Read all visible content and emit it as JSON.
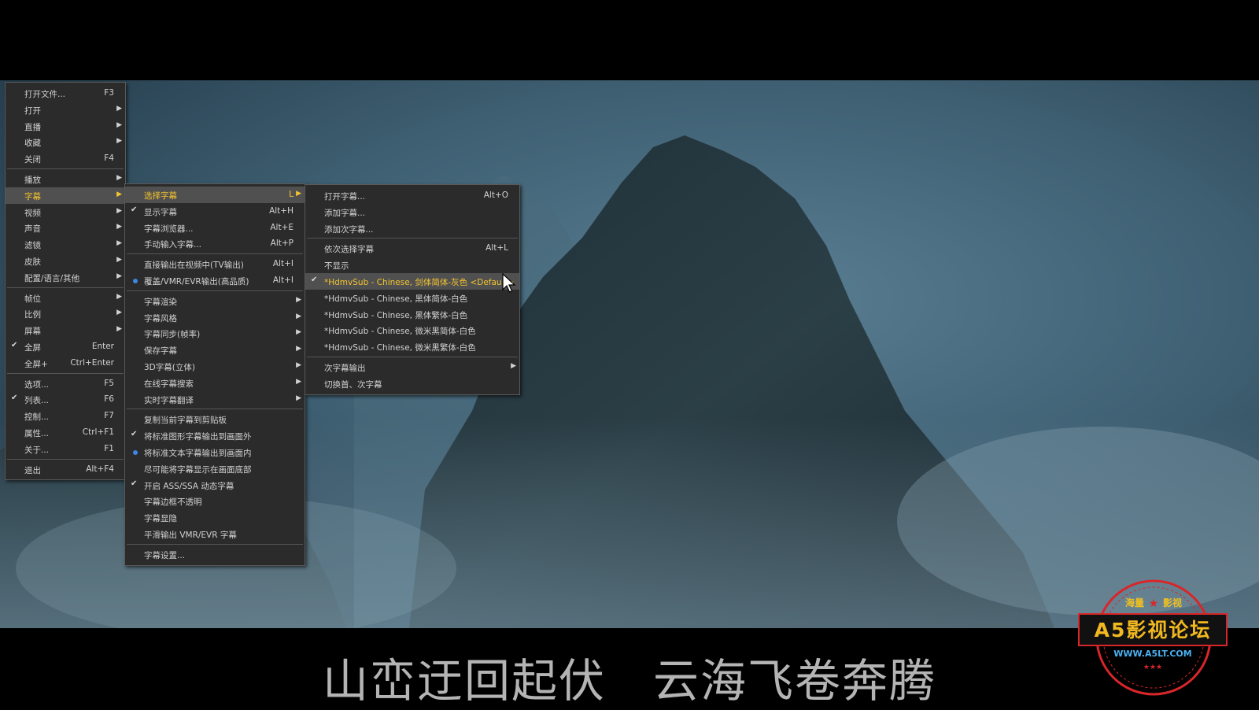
{
  "subtitle": "山峦迂回起伏　云海飞卷奔腾",
  "colors": {
    "highlight_text": "#f4c430",
    "menu_bg": "#2b2b2b",
    "radio_dot": "#3a87e8",
    "watermark_red": "#d8262a"
  },
  "main_menu": {
    "groups": [
      [
        {
          "label": "打开文件...",
          "shortcut": "F3"
        },
        {
          "label": "打开",
          "submenu": true
        },
        {
          "label": "直播",
          "submenu": true
        },
        {
          "label": "收藏",
          "submenu": true
        },
        {
          "label": "关闭",
          "shortcut": "F4"
        }
      ],
      [
        {
          "label": "播放",
          "submenu": true
        },
        {
          "label": "字幕",
          "submenu": true,
          "highlighted": true
        },
        {
          "label": "视频",
          "submenu": true
        },
        {
          "label": "声音",
          "submenu": true
        },
        {
          "label": "滤镜",
          "submenu": true
        },
        {
          "label": "皮肤",
          "submenu": true
        },
        {
          "label": "配置/语言/其他",
          "submenu": true
        }
      ],
      [
        {
          "label": "帧位",
          "submenu": true
        },
        {
          "label": "比例",
          "submenu": true
        },
        {
          "label": "屏幕",
          "submenu": true
        },
        {
          "label": "全屏",
          "shortcut": "Enter",
          "checked": true
        },
        {
          "label": "全屏+",
          "shortcut": "Ctrl+Enter"
        }
      ],
      [
        {
          "label": "选项...",
          "shortcut": "F5"
        },
        {
          "label": "列表...",
          "shortcut": "F6",
          "checked": true
        },
        {
          "label": "控制...",
          "shortcut": "F7"
        },
        {
          "label": "属性...",
          "shortcut": "Ctrl+F1"
        },
        {
          "label": "关于...",
          "shortcut": "F1"
        }
      ],
      [
        {
          "label": "退出",
          "shortcut": "Alt+F4"
        }
      ]
    ]
  },
  "subtitle_menu": {
    "groups": [
      [
        {
          "label": "选择字幕",
          "shortcut": "L",
          "submenu": true,
          "highlighted": true
        },
        {
          "label": "显示字幕",
          "shortcut": "Alt+H",
          "checked": true
        },
        {
          "label": "字幕浏览器...",
          "shortcut": "Alt+E"
        },
        {
          "label": "手动输入字幕...",
          "shortcut": "Alt+P"
        }
      ],
      [
        {
          "label": "直接输出在视频中(TV输出)",
          "shortcut": "Alt+I"
        },
        {
          "label": "覆盖/VMR/EVR输出(高品质)",
          "shortcut": "Alt+I",
          "radio": true
        }
      ],
      [
        {
          "label": "字幕渲染",
          "submenu": true
        },
        {
          "label": "字幕风格",
          "submenu": true
        },
        {
          "label": "字幕同步(帧率)",
          "submenu": true
        },
        {
          "label": "保存字幕",
          "submenu": true
        },
        {
          "label": "3D字幕(立体)",
          "submenu": true
        },
        {
          "label": "在线字幕搜索",
          "submenu": true
        },
        {
          "label": "实时字幕翻译",
          "submenu": true
        }
      ],
      [
        {
          "label": "复制当前字幕到剪贴板"
        },
        {
          "label": "将标准图形字幕输出到画面外",
          "checked": true
        },
        {
          "label": "将标准文本字幕输出到画面内",
          "radio": true
        },
        {
          "label": "尽可能将字幕显示在画面底部"
        },
        {
          "label": "开启 ASS/SSA 动态字幕",
          "checked": true
        },
        {
          "label": "字幕边框不透明"
        },
        {
          "label": "字幕显隐"
        },
        {
          "label": "平滑输出 VMR/EVR 字幕"
        }
      ],
      [
        {
          "label": "字幕设置..."
        }
      ]
    ]
  },
  "select_menu": {
    "groups": [
      [
        {
          "label": "打开字幕...",
          "shortcut": "Alt+O"
        },
        {
          "label": "添加字幕..."
        },
        {
          "label": "添加次字幕..."
        }
      ],
      [
        {
          "label": "依次选择字幕",
          "shortcut": "Alt+L"
        },
        {
          "label": "不显示"
        },
        {
          "label": "*HdmvSub - Chinese, 剑体简体-灰色 <Default>",
          "checked": true,
          "highlighted": true
        },
        {
          "label": "*HdmvSub - Chinese, 黑体简体-白色"
        },
        {
          "label": "*HdmvSub - Chinese, 黑体繁体-白色"
        },
        {
          "label": "*HdmvSub - Chinese, 微米黑简体-白色"
        },
        {
          "label": "*HdmvSub - Chinese, 微米黑繁体-白色"
        }
      ],
      [
        {
          "label": "次字幕输出",
          "submenu": true
        },
        {
          "label": "切换首、次字幕"
        }
      ]
    ]
  },
  "watermark": {
    "top_left": "海量",
    "top_right": "影视",
    "title": "A5影视论坛",
    "url": "WWW.A5LT.COM"
  }
}
